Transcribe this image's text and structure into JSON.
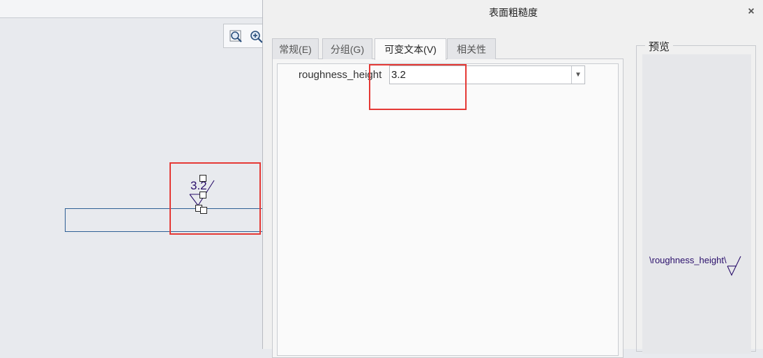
{
  "dialog": {
    "title": "表面粗糙度",
    "close_icon": "close-icon",
    "tabs": [
      {
        "label": "常规(E)",
        "active": false
      },
      {
        "label": "分组(G)",
        "active": false
      },
      {
        "label": "可变文本(V)",
        "active": true
      },
      {
        "label": "相关性",
        "active": false
      }
    ],
    "variable": {
      "name": "roughness_height",
      "value": "3.2"
    },
    "preview": {
      "title": "预览",
      "symbol_text": "\\roughness_height\\"
    }
  },
  "canvas": {
    "toolbar_icons": [
      "zoom-window-icon",
      "zoom-in-icon"
    ],
    "symbol_value": "3.2",
    "highlight_color": "#e53935",
    "symbol_color": "#2a0f6b",
    "edge_color": "#2e5f94"
  }
}
